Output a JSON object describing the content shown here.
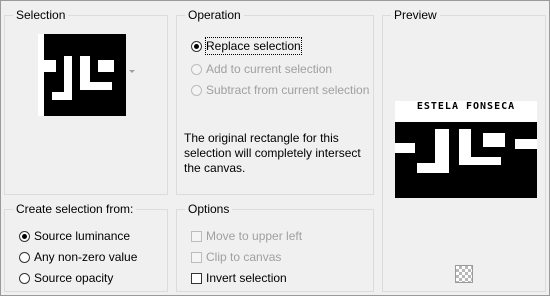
{
  "selection": {
    "title": "Selection"
  },
  "operation": {
    "title": "Operation",
    "options": [
      {
        "label": "Replace selection",
        "selected": true,
        "enabled": true
      },
      {
        "label": "Add to current selection",
        "selected": false,
        "enabled": false
      },
      {
        "label": "Subtract from current selection",
        "selected": false,
        "enabled": false
      }
    ],
    "description": "The original rectangle for this selection will completely intersect the canvas."
  },
  "preview": {
    "title": "Preview",
    "caption": "ESTELA FONSECA"
  },
  "create_from": {
    "title": "Create selection from:",
    "options": [
      {
        "label": "Source luminance",
        "selected": true
      },
      {
        "label": "Any non-zero value",
        "selected": false
      },
      {
        "label": "Source opacity",
        "selected": false
      }
    ]
  },
  "options": {
    "title": "Options",
    "items": [
      {
        "label": "Move to upper left",
        "checked": false,
        "enabled": false
      },
      {
        "label": "Clip to canvas",
        "checked": false,
        "enabled": false
      },
      {
        "label": "Invert selection",
        "checked": false,
        "enabled": true
      }
    ]
  }
}
